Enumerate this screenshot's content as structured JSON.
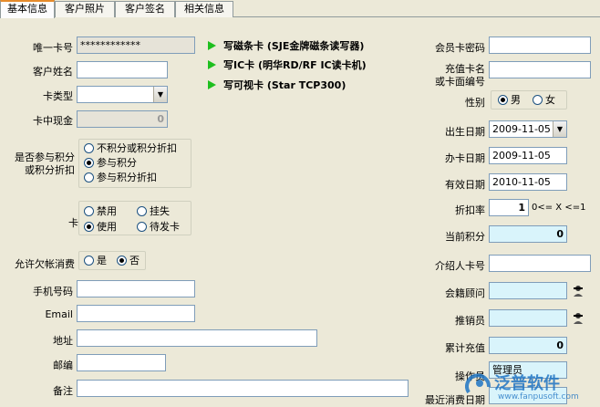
{
  "tabs": [
    "基本信息",
    "客户照片",
    "客户签名",
    "相关信息"
  ],
  "left": {
    "card_no": {
      "label": "唯一卡号",
      "value": "************"
    },
    "name": {
      "label": "客户姓名",
      "value": ""
    },
    "card_type": {
      "label": "卡类型",
      "value": ""
    },
    "cash": {
      "label": "卡中现金",
      "value": "0"
    },
    "points_mode": {
      "label_line1": "是否参与积分",
      "label_line2": "或积分折扣",
      "options": [
        "不积分或积分折扣",
        "参与积分",
        "参与积分折扣"
      ],
      "selected": 1
    },
    "status": {
      "label": "卡状态",
      "options": [
        "禁用",
        "挂失",
        "使用",
        "待发卡"
      ],
      "selected": 2
    },
    "overdraft": {
      "label": "允许欠帐消费",
      "options": [
        "是",
        "否"
      ],
      "selected": 1
    },
    "mobile": {
      "label": "手机号码",
      "value": ""
    },
    "email": {
      "label": "Email",
      "value": ""
    },
    "address": {
      "label": "地址",
      "value": ""
    },
    "zip": {
      "label": "邮编",
      "value": ""
    },
    "note": {
      "label": "备注",
      "value": ""
    }
  },
  "actions": [
    "写磁条卡 (SJE金牌磁条读写器)",
    "写IC卡 (明华RD/RF IC读卡机)",
    "写可视卡 (Star TCP300)"
  ],
  "right": {
    "password": {
      "label": "会员卡密码",
      "value": ""
    },
    "face_name": {
      "label_line1": "充值卡名",
      "label_line2": "或卡面编号",
      "value": ""
    },
    "gender": {
      "label": "性别",
      "options": [
        "男",
        "女"
      ],
      "selected": 0
    },
    "birth": {
      "label": "出生日期",
      "value": "2009-11-05"
    },
    "issue": {
      "label": "办卡日期",
      "value": "2009-11-05"
    },
    "expire": {
      "label": "有效日期",
      "value": "2010-11-05"
    },
    "discount": {
      "label": "折扣率",
      "value": "1",
      "hint": "0<= X <=1"
    },
    "points": {
      "label": "当前积分",
      "value": "0"
    },
    "referrer": {
      "label": "介绍人卡号",
      "value": ""
    },
    "consultant": {
      "label": "会籍顾问",
      "value": ""
    },
    "seller": {
      "label": "推销员",
      "value": ""
    },
    "recharge": {
      "label": "累计充值",
      "value": "0"
    },
    "operator": {
      "label": "操作员",
      "value": "管理员"
    },
    "last_date": {
      "label": "最近消费日期",
      "value": ""
    }
  },
  "watermark": {
    "brand": "泛普软件",
    "url": "www.fanpusoft.com"
  },
  "colors": {
    "accent_green": "#1ebf1e",
    "tab_highlight": "#e68b2c",
    "readonly_blue": "#d9f4fb"
  }
}
